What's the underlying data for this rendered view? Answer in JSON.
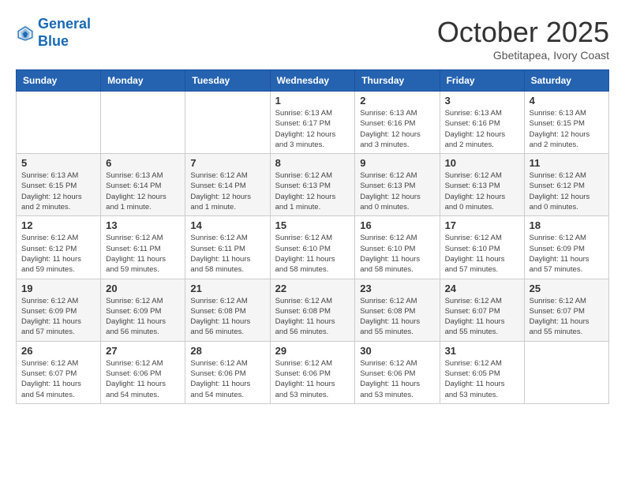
{
  "header": {
    "logo_line1": "General",
    "logo_line2": "Blue",
    "month": "October 2025",
    "location": "Gbetitapea, Ivory Coast"
  },
  "weekdays": [
    "Sunday",
    "Monday",
    "Tuesday",
    "Wednesday",
    "Thursday",
    "Friday",
    "Saturday"
  ],
  "weeks": [
    [
      {
        "day": "",
        "info": ""
      },
      {
        "day": "",
        "info": ""
      },
      {
        "day": "",
        "info": ""
      },
      {
        "day": "1",
        "info": "Sunrise: 6:13 AM\nSunset: 6:17 PM\nDaylight: 12 hours\nand 3 minutes."
      },
      {
        "day": "2",
        "info": "Sunrise: 6:13 AM\nSunset: 6:16 PM\nDaylight: 12 hours\nand 3 minutes."
      },
      {
        "day": "3",
        "info": "Sunrise: 6:13 AM\nSunset: 6:16 PM\nDaylight: 12 hours\nand 2 minutes."
      },
      {
        "day": "4",
        "info": "Sunrise: 6:13 AM\nSunset: 6:15 PM\nDaylight: 12 hours\nand 2 minutes."
      }
    ],
    [
      {
        "day": "5",
        "info": "Sunrise: 6:13 AM\nSunset: 6:15 PM\nDaylight: 12 hours\nand 2 minutes."
      },
      {
        "day": "6",
        "info": "Sunrise: 6:13 AM\nSunset: 6:14 PM\nDaylight: 12 hours\nand 1 minute."
      },
      {
        "day": "7",
        "info": "Sunrise: 6:12 AM\nSunset: 6:14 PM\nDaylight: 12 hours\nand 1 minute."
      },
      {
        "day": "8",
        "info": "Sunrise: 6:12 AM\nSunset: 6:13 PM\nDaylight: 12 hours\nand 1 minute."
      },
      {
        "day": "9",
        "info": "Sunrise: 6:12 AM\nSunset: 6:13 PM\nDaylight: 12 hours\nand 0 minutes."
      },
      {
        "day": "10",
        "info": "Sunrise: 6:12 AM\nSunset: 6:13 PM\nDaylight: 12 hours\nand 0 minutes."
      },
      {
        "day": "11",
        "info": "Sunrise: 6:12 AM\nSunset: 6:12 PM\nDaylight: 12 hours\nand 0 minutes."
      }
    ],
    [
      {
        "day": "12",
        "info": "Sunrise: 6:12 AM\nSunset: 6:12 PM\nDaylight: 11 hours\nand 59 minutes."
      },
      {
        "day": "13",
        "info": "Sunrise: 6:12 AM\nSunset: 6:11 PM\nDaylight: 11 hours\nand 59 minutes."
      },
      {
        "day": "14",
        "info": "Sunrise: 6:12 AM\nSunset: 6:11 PM\nDaylight: 11 hours\nand 58 minutes."
      },
      {
        "day": "15",
        "info": "Sunrise: 6:12 AM\nSunset: 6:10 PM\nDaylight: 11 hours\nand 58 minutes."
      },
      {
        "day": "16",
        "info": "Sunrise: 6:12 AM\nSunset: 6:10 PM\nDaylight: 11 hours\nand 58 minutes."
      },
      {
        "day": "17",
        "info": "Sunrise: 6:12 AM\nSunset: 6:10 PM\nDaylight: 11 hours\nand 57 minutes."
      },
      {
        "day": "18",
        "info": "Sunrise: 6:12 AM\nSunset: 6:09 PM\nDaylight: 11 hours\nand 57 minutes."
      }
    ],
    [
      {
        "day": "19",
        "info": "Sunrise: 6:12 AM\nSunset: 6:09 PM\nDaylight: 11 hours\nand 57 minutes."
      },
      {
        "day": "20",
        "info": "Sunrise: 6:12 AM\nSunset: 6:09 PM\nDaylight: 11 hours\nand 56 minutes."
      },
      {
        "day": "21",
        "info": "Sunrise: 6:12 AM\nSunset: 6:08 PM\nDaylight: 11 hours\nand 56 minutes."
      },
      {
        "day": "22",
        "info": "Sunrise: 6:12 AM\nSunset: 6:08 PM\nDaylight: 11 hours\nand 56 minutes."
      },
      {
        "day": "23",
        "info": "Sunrise: 6:12 AM\nSunset: 6:08 PM\nDaylight: 11 hours\nand 55 minutes."
      },
      {
        "day": "24",
        "info": "Sunrise: 6:12 AM\nSunset: 6:07 PM\nDaylight: 11 hours\nand 55 minutes."
      },
      {
        "day": "25",
        "info": "Sunrise: 6:12 AM\nSunset: 6:07 PM\nDaylight: 11 hours\nand 55 minutes."
      }
    ],
    [
      {
        "day": "26",
        "info": "Sunrise: 6:12 AM\nSunset: 6:07 PM\nDaylight: 11 hours\nand 54 minutes."
      },
      {
        "day": "27",
        "info": "Sunrise: 6:12 AM\nSunset: 6:06 PM\nDaylight: 11 hours\nand 54 minutes."
      },
      {
        "day": "28",
        "info": "Sunrise: 6:12 AM\nSunset: 6:06 PM\nDaylight: 11 hours\nand 54 minutes."
      },
      {
        "day": "29",
        "info": "Sunrise: 6:12 AM\nSunset: 6:06 PM\nDaylight: 11 hours\nand 53 minutes."
      },
      {
        "day": "30",
        "info": "Sunrise: 6:12 AM\nSunset: 6:06 PM\nDaylight: 11 hours\nand 53 minutes."
      },
      {
        "day": "31",
        "info": "Sunrise: 6:12 AM\nSunset: 6:05 PM\nDaylight: 11 hours\nand 53 minutes."
      },
      {
        "day": "",
        "info": ""
      }
    ]
  ]
}
